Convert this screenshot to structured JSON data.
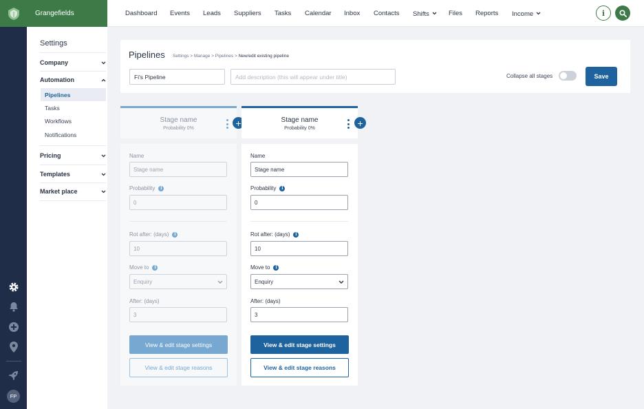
{
  "app": {
    "name": "Grangefields"
  },
  "nav": {
    "items": [
      {
        "label": "Dashboard"
      },
      {
        "label": "Events"
      },
      {
        "label": "Leads"
      },
      {
        "label": "Suppliers"
      },
      {
        "label": "Tasks"
      },
      {
        "label": "Calendar"
      },
      {
        "label": "Inbox"
      },
      {
        "label": "Contacts"
      },
      {
        "label": "Shifts",
        "dropdown": true
      },
      {
        "label": "Files"
      },
      {
        "label": "Reports"
      },
      {
        "label": "Income",
        "dropdown": true
      }
    ],
    "info_icon": "info-icon",
    "search_icon": "search-icon"
  },
  "rail": {
    "icons": [
      "gear-icon",
      "bell-icon",
      "plus-circle-icon",
      "map-pin-icon",
      "rocket-icon"
    ],
    "avatar_initials": "FP"
  },
  "settings": {
    "title": "Settings",
    "groups": {
      "company": "Company",
      "automation": "Automation",
      "pricing": "Pricing",
      "templates": "Templates",
      "marketplace": "Market place"
    },
    "automation_items": [
      "Pipelines",
      "Tasks",
      "Workflows",
      "Notifications"
    ],
    "active_item": "Pipelines"
  },
  "header": {
    "title": "Pipelines",
    "breadcrumb": "Settings  >  Manage > Pipelines  >",
    "breadcrumb_current": "New/edit existing pipeline",
    "name_value": "Fi's Pipeline",
    "description_placeholder": "Add description (this will appear under title)",
    "collapse_label": "Collapse all stages",
    "collapse_on": false,
    "save_label": "Save"
  },
  "stages": [
    {
      "name": "Stage name",
      "probability_label": "Probability 0%",
      "name_label": "Name",
      "name_value": "Stage name",
      "prob_label": "Probability",
      "prob_value": "0",
      "rot_label": "Rot after: (days)",
      "rot_value": "10",
      "move_label": "Move to",
      "move_value": "Enquiry",
      "after_label": "After: (days)",
      "after_value": "3",
      "settings_btn": "View & edit stage settings",
      "reasons_btn": "View & edit stage reasons"
    },
    {
      "name": "Stage name",
      "probability_label": "Probability 0%",
      "name_label": "Name",
      "name_value": "Stage name",
      "prob_label": "Probability",
      "prob_value": "0",
      "rot_label": "Rot after: (days)",
      "rot_value": "10",
      "move_label": "Move to",
      "move_value": "Enquiry",
      "after_label": "After: (days)",
      "after_value": "3",
      "settings_btn": "View & edit stage settings",
      "reasons_btn": "View & edit stage reasons"
    }
  ],
  "colors": {
    "brand_green": "#3d7a47",
    "rail": "#1f2d48",
    "primary_blue": "#1e639d",
    "muted_blue": "#76a8d1"
  }
}
